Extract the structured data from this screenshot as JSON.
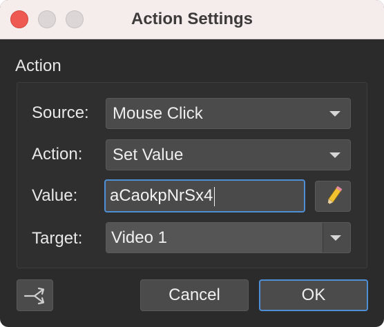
{
  "window": {
    "title": "Action Settings"
  },
  "section": {
    "label": "Action"
  },
  "rows": {
    "source": {
      "label": "Source:",
      "value": "Mouse Click"
    },
    "action": {
      "label": "Action:",
      "value": "Set Value"
    },
    "value": {
      "label": "Value:",
      "value": "aCaokpNrSx4"
    },
    "target": {
      "label": "Target:",
      "value": "Video 1"
    }
  },
  "buttons": {
    "cancel": "Cancel",
    "ok": "OK"
  },
  "icons": {
    "pencil": "pencil-icon",
    "workflow": "split-arrows-icon"
  },
  "colors": {
    "accent": "#4f8fd6",
    "close": "#ee5a52",
    "pencil_body": "#f2c230"
  }
}
